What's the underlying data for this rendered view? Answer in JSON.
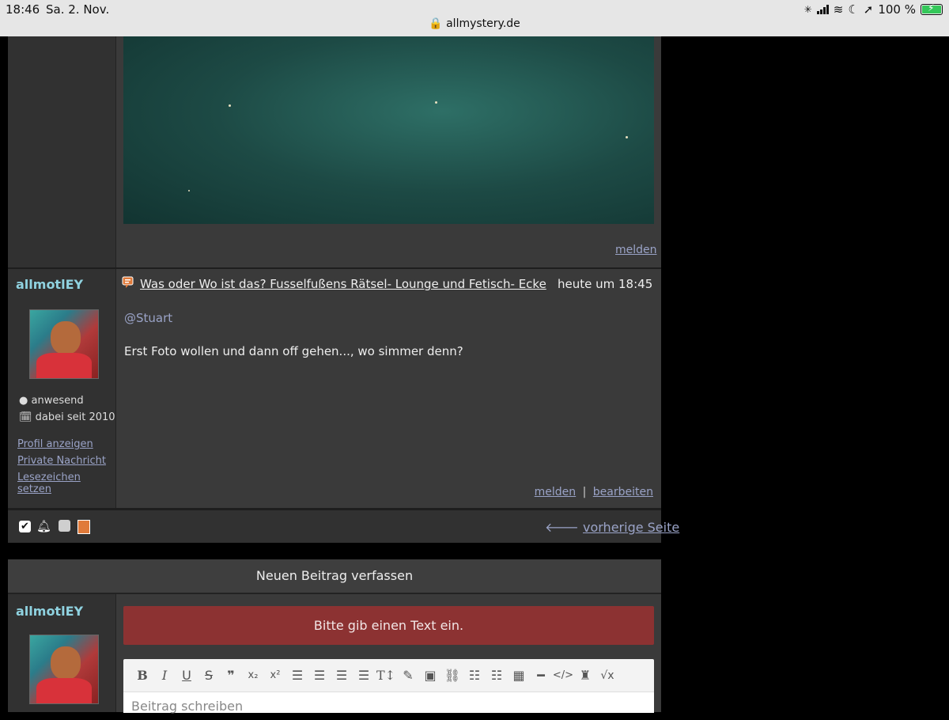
{
  "status_bar": {
    "time": "18:46",
    "date": "Sa. 2. Nov.",
    "url": "allmystery.de",
    "battery": "100 %"
  },
  "post1": {
    "report_label": "melden"
  },
  "post2": {
    "username": "allmotlEY",
    "status": "anwesend",
    "member_since": "dabei seit 2010",
    "profile_link": "Profil anzeigen",
    "pm_link": "Private Nachricht",
    "bookmark_link": "Lesezeichen setzen",
    "thread_title": "Was oder Wo ist das? Fusselfußens Rätsel- Lounge und Fetisch- Ecke",
    "timestamp": "heute um 18:45",
    "mention": "@Stuart",
    "text": "Erst Foto wollen und dann off gehen..., wo simmer denn?",
    "report_label": "melden",
    "separator": "|",
    "edit_label": "bearbeiten"
  },
  "pagination": {
    "prev_label": "vorherige Seite"
  },
  "compose": {
    "header": "Neuen Beitrag verfassen",
    "username": "allmotlEY",
    "error": "Bitte gib einen Text ein.",
    "placeholder": "Beitrag schreiben",
    "toolbar_icons": [
      "bold",
      "italic",
      "underline",
      "strikethrough",
      "quote",
      "subscript",
      "superscript",
      "align-left",
      "align-center",
      "align-right",
      "justify",
      "text-size",
      "pencil",
      "image",
      "link",
      "bullet-list",
      "numbered-list",
      "table",
      "horizontal-rule",
      "code",
      "spoiler",
      "formula"
    ]
  }
}
